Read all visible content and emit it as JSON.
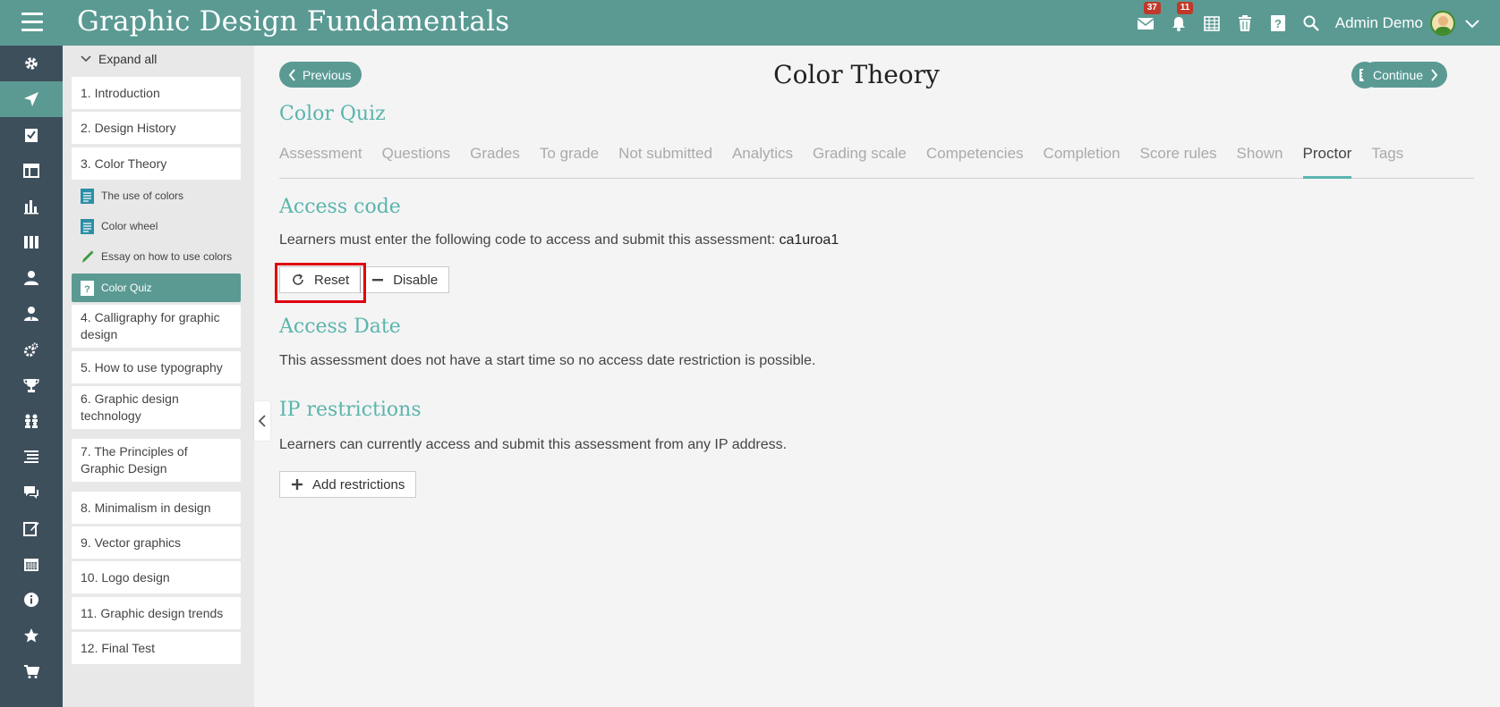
{
  "app": {
    "title": "Graphic Design Fundamentals",
    "accent": "#5a9a93",
    "mail_badge": "37",
    "notif_badge": "11",
    "user_name": "Admin Demo"
  },
  "sidebar": {
    "expand_all": "Expand all",
    "items": [
      {
        "label": "1. Introduction"
      },
      {
        "label": "2. Design History"
      },
      {
        "label": "3. Color Theory"
      },
      {
        "label": "The use of colors"
      },
      {
        "label": "Color wheel"
      },
      {
        "label": "Essay on how to use colors"
      },
      {
        "label": "Color Quiz"
      },
      {
        "label": "4. Calligraphy for graphic design"
      },
      {
        "label": "5. How to use typography"
      },
      {
        "label": "6. Graphic design technology"
      },
      {
        "label": "7. The Principles of Graphic Design"
      },
      {
        "label": "8. Minimalism in design"
      },
      {
        "label": "9. Vector graphics"
      },
      {
        "label": "10. Logo design"
      },
      {
        "label": "11. Graphic design trends"
      },
      {
        "label": "12. Final Test"
      }
    ]
  },
  "page": {
    "previous_label": "Previous",
    "title": "Color Theory",
    "continue_label": "Continue",
    "quiz_title": "Color Quiz"
  },
  "tabs": [
    {
      "label": "Assessment"
    },
    {
      "label": "Questions"
    },
    {
      "label": "Grades"
    },
    {
      "label": "To grade"
    },
    {
      "label": "Not submitted"
    },
    {
      "label": "Analytics"
    },
    {
      "label": "Grading scale"
    },
    {
      "label": "Competencies"
    },
    {
      "label": "Completion"
    },
    {
      "label": "Score rules"
    },
    {
      "label": "Shown"
    },
    {
      "label": "Proctor",
      "active": true
    },
    {
      "label": "Tags"
    }
  ],
  "access_code": {
    "title": "Access code",
    "text": "Learners must enter the following code to access and submit this assessment: ",
    "code": "ca1uroa1",
    "reset_label": "Reset",
    "disable_label": "Disable"
  },
  "access_date": {
    "title": "Access Date",
    "text": "This assessment does not have a start time so no access date restriction is possible."
  },
  "ip": {
    "title": "IP restrictions",
    "text": "Learners can currently access and submit this assessment from any IP address.",
    "add_label": "Add restrictions"
  }
}
